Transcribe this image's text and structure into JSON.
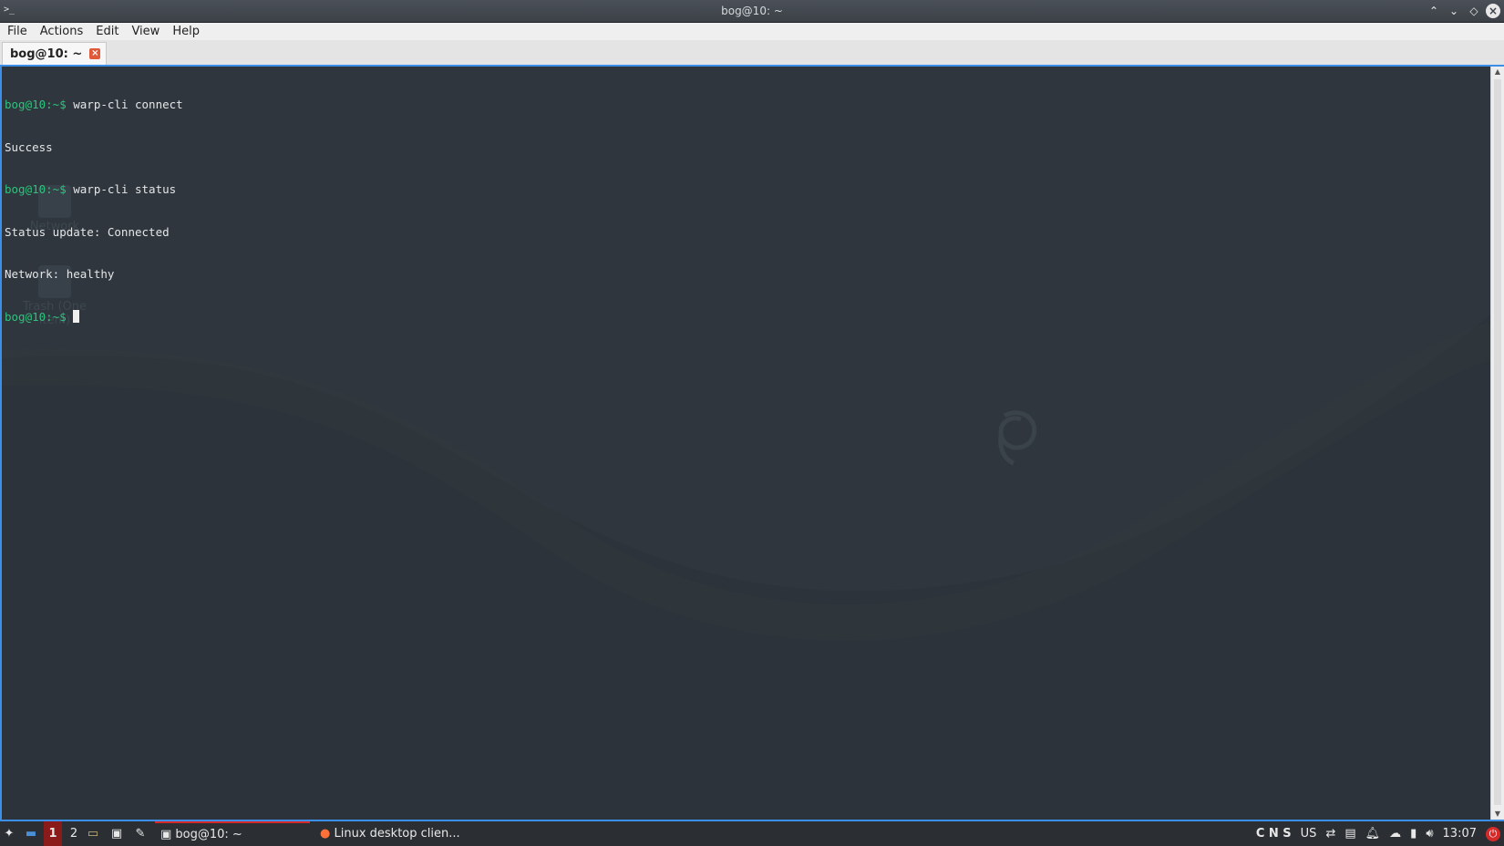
{
  "window": {
    "title": "bog@10: ~",
    "app_icon": ">_"
  },
  "menubar": {
    "items": [
      "File",
      "Actions",
      "Edit",
      "View",
      "Help"
    ]
  },
  "tabs": [
    {
      "label": "bog@10: ~",
      "close_glyph": "×"
    }
  ],
  "terminal": {
    "lines": [
      {
        "prompt": "bog@10:~$",
        "text": " warp-cli connect"
      },
      {
        "prompt": "",
        "text": "Success"
      },
      {
        "prompt": "bog@10:~$",
        "text": " warp-cli status"
      },
      {
        "prompt": "",
        "text": "Status update: Connected"
      },
      {
        "prompt": "",
        "text": "Network: healthy"
      },
      {
        "prompt": "bog@10:~$",
        "text": " "
      }
    ]
  },
  "desktop_icons": [
    {
      "label": "Network",
      "icon": "network-folder-icon"
    },
    {
      "label": "Trash (One item)",
      "icon": "trash-icon"
    }
  ],
  "taskbar": {
    "workspaces": [
      "1",
      "2"
    ],
    "tasks": [
      {
        "label": "bog@10: ~",
        "icon": "terminal-icon",
        "active": true
      },
      {
        "label": "Linux desktop clien...",
        "icon": "firefox-icon",
        "active": false
      }
    ],
    "tray": {
      "indicators": "C N S",
      "keyboard_layout": "US",
      "clock": "13:07"
    }
  },
  "colors": {
    "accent": "#3d8ee6",
    "prompt": "#2ec27e",
    "terminal_bg": "#2f363d",
    "active_task": "#d42a2a"
  }
}
